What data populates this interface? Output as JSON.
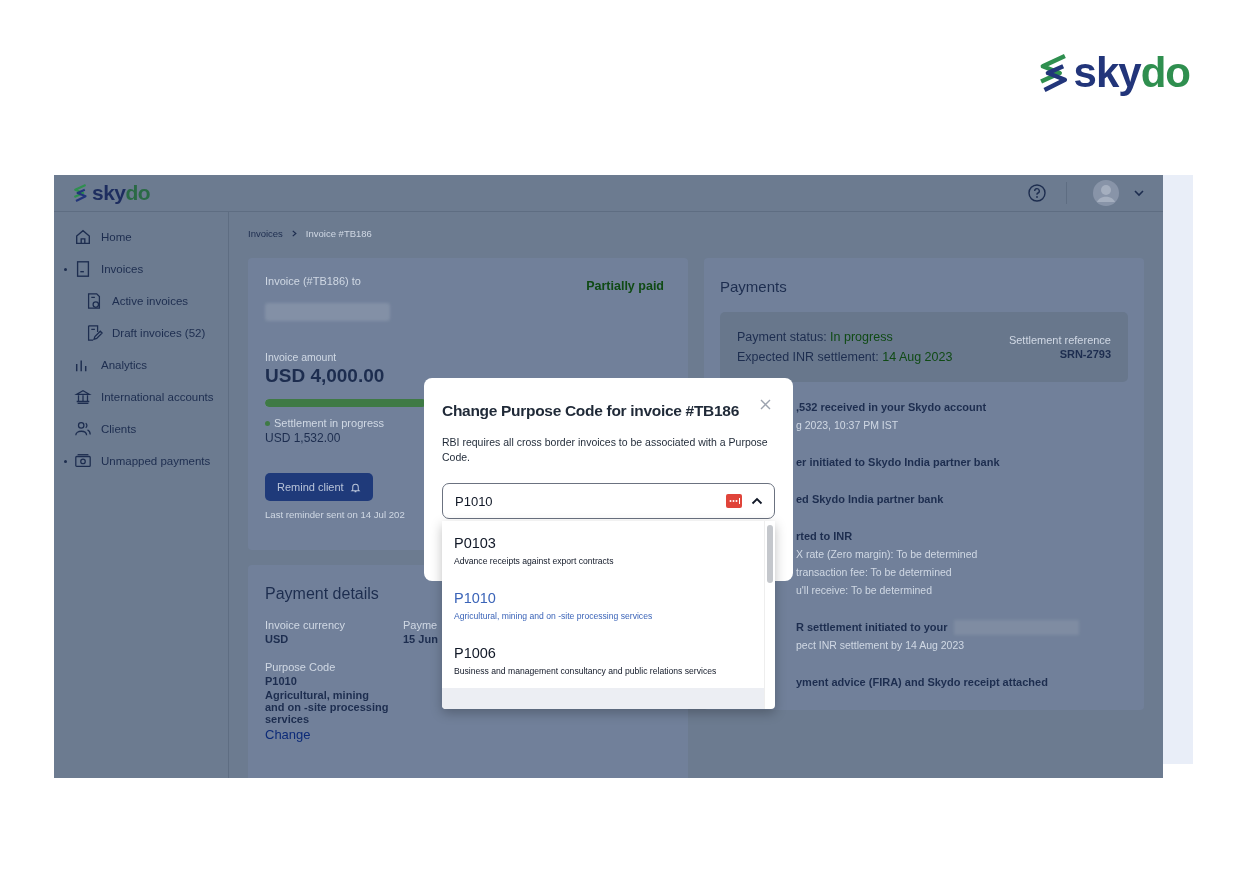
{
  "brand_logo": {
    "text": "sky",
    "accent": "do"
  },
  "app": {
    "logo": {
      "text": "sky",
      "accent": "do"
    },
    "sidebar": {
      "items": [
        {
          "label": "Home",
          "expandable": false
        },
        {
          "label": "Invoices",
          "expandable": true,
          "children": [
            {
              "label": "Active invoices"
            },
            {
              "label": "Draft invoices (52)"
            }
          ]
        },
        {
          "label": "Analytics",
          "expandable": false
        },
        {
          "label": "International accounts",
          "expandable": false
        },
        {
          "label": "Clients",
          "expandable": false
        },
        {
          "label": "Unmapped payments",
          "expandable": true
        }
      ]
    },
    "breadcrumb": [
      "Invoices",
      "Invoice #TB186"
    ],
    "invoice_card": {
      "recipient_label": "Invoice (#TB186) to",
      "status": "Partially paid",
      "amount_label": "Invoice amount",
      "amount": "USD 4,000.00",
      "progress": {
        "level": 0.383
      },
      "settled_label": "Settlement in progress",
      "settled_amount": "USD 1,532.00",
      "remind_button": "Remind client",
      "reminder_note": "Last reminder sent on 14 Jul 202"
    },
    "payment_details": {
      "title": "Payment details",
      "fields": [
        {
          "label": "Invoice currency",
          "value": "USD"
        },
        {
          "label": "Payme",
          "value": "15 Jun"
        }
      ],
      "purpose": {
        "label": "Purpose Code",
        "code": "P1010",
        "description": "Agricultural, mining and on -site processing services",
        "action": "Change"
      }
    },
    "payments": {
      "title": "Payments",
      "status_label": "Payment status:",
      "status": "In progress",
      "expected_label": "Expected INR settlement:",
      "expected_date": "14 Aug 2023",
      "reference_label": "Settlement reference",
      "reference": "SRN-2793",
      "timeline": [
        {
          "title": ",532 received in your Skydo account",
          "redacted": false,
          "details": [
            "g 2023, 10:37 PM IST"
          ]
        },
        {
          "title": "er initiated to Skydo India partner bank",
          "redacted": false
        },
        {
          "title": "ed Skydo India partner bank",
          "redacted": false
        },
        {
          "title": "rted to INR",
          "redacted": false,
          "details": [
            "X rate (Zero margin): To be determined",
            "transaction fee: To be determined",
            "u'll receive: To be determined"
          ]
        },
        {
          "title": "R settlement initiated to your",
          "redacted": true,
          "details": [
            "pect INR settlement by 14 Aug 2023"
          ]
        },
        {
          "title": "yment advice (FIRA) and Skydo receipt attached",
          "redacted": false
        }
      ]
    }
  },
  "modal": {
    "title": "Change Purpose Code for invoice #TB186",
    "description": "RBI requires all cross border invoices to be associated with a Purpose Code.",
    "field": {
      "value": "P1010",
      "expanded": true
    },
    "options": [
      {
        "code": "P0103",
        "description": "Advance receipts against export contracts",
        "selected": false
      },
      {
        "code": "P1010",
        "description": "Agricultural, mining and on -site processing services",
        "selected": true
      },
      {
        "code": "P1006",
        "description": "Business and management consultancy and public relations services",
        "selected": false
      }
    ]
  }
}
